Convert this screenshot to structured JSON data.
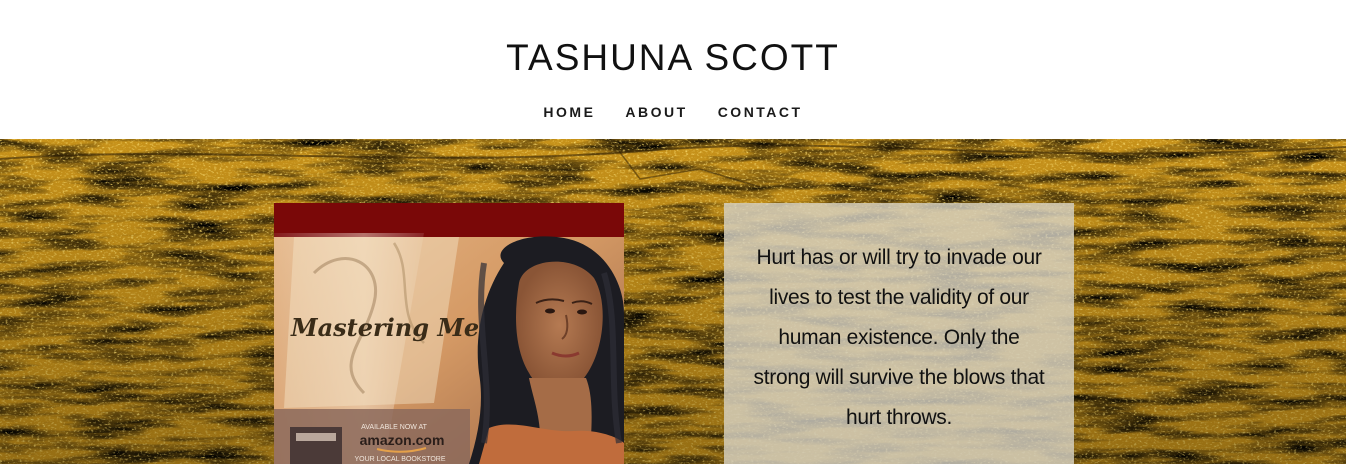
{
  "header": {
    "site_title": "TASHUNA SCOTT",
    "nav": [
      {
        "label": "HOME"
      },
      {
        "label": "ABOUT"
      },
      {
        "label": "CONTACT"
      }
    ]
  },
  "hero": {
    "background": "gold-textured-wall",
    "book_cover": {
      "title": "Mastering Me",
      "available_text": "AVAILABLE NOW AT",
      "store": "amazon.com",
      "local_text": "YOUR LOCAL BOOKSTORE"
    },
    "quote": "Hurt has or will try to invade our lives to test the validity of our human existence. Only the strong will survive the blows that hurt throws."
  },
  "colors": {
    "header_bg": "#ffffff",
    "title_text": "#111111",
    "hero_gold": "#c99415",
    "hero_dark": "#4a3408",
    "book_red": "#7a0c0c",
    "quote_panel": "#d7d2c3"
  }
}
